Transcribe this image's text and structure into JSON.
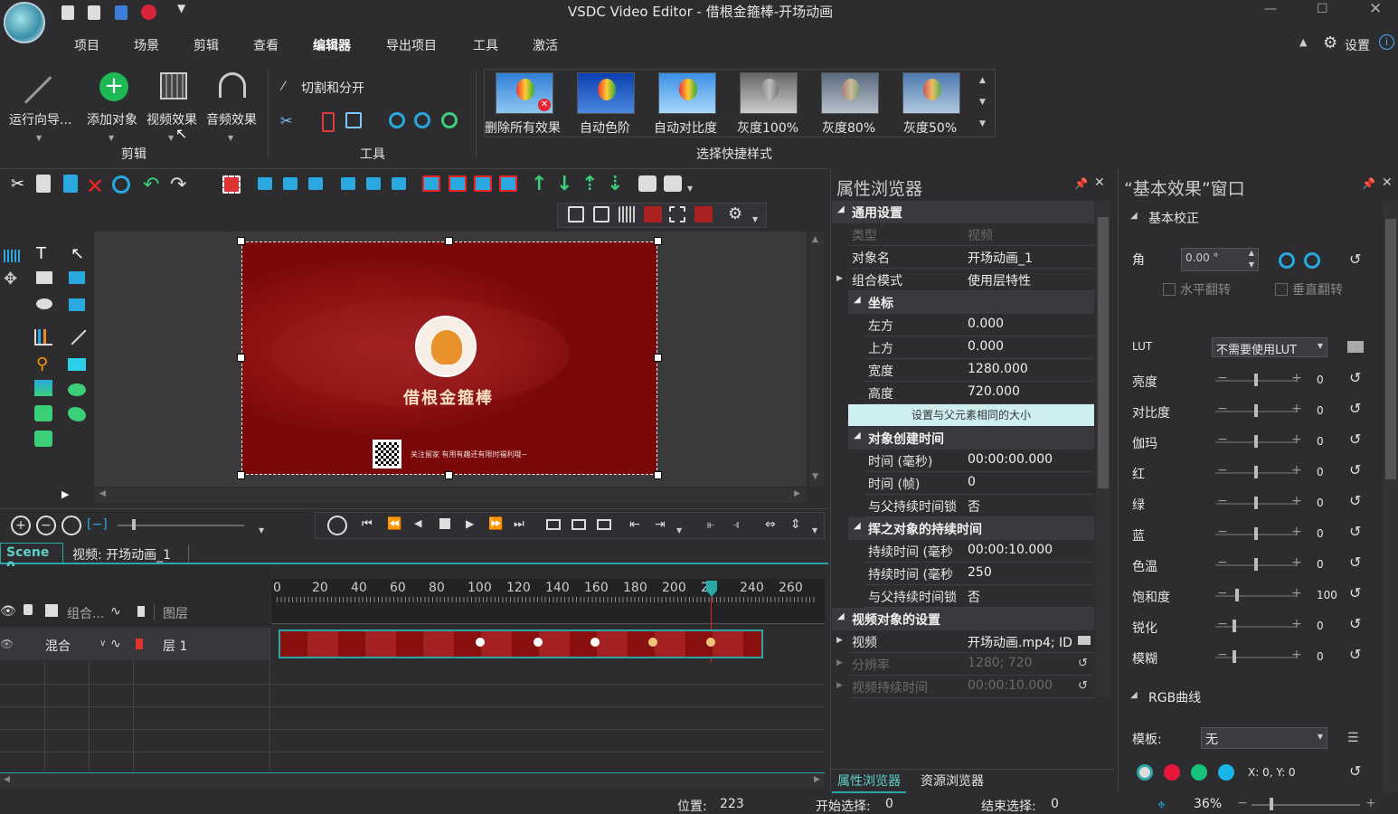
{
  "window": {
    "title": "VSDC Video Editor - 借根金箍棒-开场动画"
  },
  "menu": {
    "items": [
      "项目",
      "场景",
      "剪辑",
      "查看",
      "编辑器",
      "导出项目",
      "工具",
      "激活"
    ],
    "settings": "设置"
  },
  "ribbon": {
    "run_wizard": "运行向导...",
    "add_object": "添加对象",
    "video_effects": "视频效果",
    "audio_effects": "音频效果",
    "group_edit": "剪辑",
    "cut_split": "切割和分开",
    "group_tools": "工具",
    "styles": [
      "删除所有效果",
      "自动色阶",
      "自动对比度",
      "灰度100%",
      "灰度80%",
      "灰度50%"
    ],
    "group_styles": "选择快捷样式"
  },
  "canvas": {
    "brand_text": "借根金箍棒",
    "footer_text": "关注留家 有用有趣还有限时福利哦~"
  },
  "timeline": {
    "tab_scene": "Scene 0",
    "tab_video": "视频: 开场动画_1",
    "header_cols": {
      "combine": "组合...",
      "layers": "图层"
    },
    "ruler": [
      "0",
      "20",
      "40",
      "60",
      "80",
      "100",
      "120",
      "140",
      "160",
      "180",
      "200",
      "22",
      "240",
      "260"
    ],
    "track": {
      "blend": "混合",
      "layer": "层 1"
    }
  },
  "properties": {
    "title": "属性浏览器",
    "sec_general": "通用设置",
    "type_label": "类型",
    "type_value": "视频",
    "name_label": "对象名",
    "name_value": "开场动画_1",
    "blend_label": "组合模式",
    "blend_value": "使用层特性",
    "sec_coords": "坐标",
    "left_label": "左方",
    "left_value": "0.000",
    "top_label": "上方",
    "top_value": "0.000",
    "width_label": "宽度",
    "width_value": "1280.000",
    "height_label": "高度",
    "height_value": "720.000",
    "parent_size_btn": "设置与父元素相同的大小",
    "sec_create": "对象创建时间",
    "time_ms_label": "时间 (毫秒)",
    "time_ms_value": "00:00:00.000",
    "time_frame_label": "时间 (帧)",
    "time_frame_value": "0",
    "sync_label": "与父持续时间锁",
    "sync_value": "否",
    "sec_duration": "挥之对象的持续时间",
    "dur_ms_label": "持续时间 (毫秒",
    "dur_ms_value": "00:00:10.000",
    "dur_frame_label": "持续时间 (毫秒",
    "dur_frame_value": "250",
    "sync2_label": "与父持续时间锁",
    "sync2_value": "否",
    "sec_video": "视频对象的设置",
    "video_label": "视频",
    "video_value": "开场动画.mp4; ID",
    "res_label": "分辨率",
    "res_value": "1280; 720",
    "vdur_label": "视频持续时间",
    "vdur_value": "00:00:10.000",
    "tab_props": "属性浏览器",
    "tab_resources": "资源浏览器"
  },
  "effects": {
    "title": "“基本效果”窗口",
    "sec_basic": "基本校正",
    "angle_label": "角",
    "angle_value": "0.00 °",
    "flip_h": "水平翻转",
    "flip_v": "垂直翻转",
    "lut_label": "LUT",
    "lut_value": "不需要使用LUT",
    "sliders": [
      {
        "label": "亮度",
        "value": "0",
        "pos": 0.5
      },
      {
        "label": "对比度",
        "value": "0",
        "pos": 0.5
      },
      {
        "label": "伽玛",
        "value": "0",
        "pos": 0.5
      },
      {
        "label": "红",
        "value": "0",
        "pos": 0.5
      },
      {
        "label": "绿",
        "value": "0",
        "pos": 0.5
      },
      {
        "label": "蓝",
        "value": "0",
        "pos": 0.5
      },
      {
        "label": "色温",
        "value": "0",
        "pos": 0.5
      },
      {
        "label": "饱和度",
        "value": "100",
        "pos": 0.2
      },
      {
        "label": "锐化",
        "value": "0",
        "pos": 0.15
      },
      {
        "label": "模糊",
        "value": "0",
        "pos": 0.15
      }
    ],
    "sec_rgb": "RGB曲线",
    "template_label": "模板:",
    "template_value": "无",
    "xy": "X: 0, Y: 0"
  },
  "status": {
    "position_label": "位置:",
    "position_value": "223",
    "start_label": "开始选择:",
    "start_value": "0",
    "end_label": "结束选择:",
    "end_value": "0",
    "zoom": "36%"
  }
}
